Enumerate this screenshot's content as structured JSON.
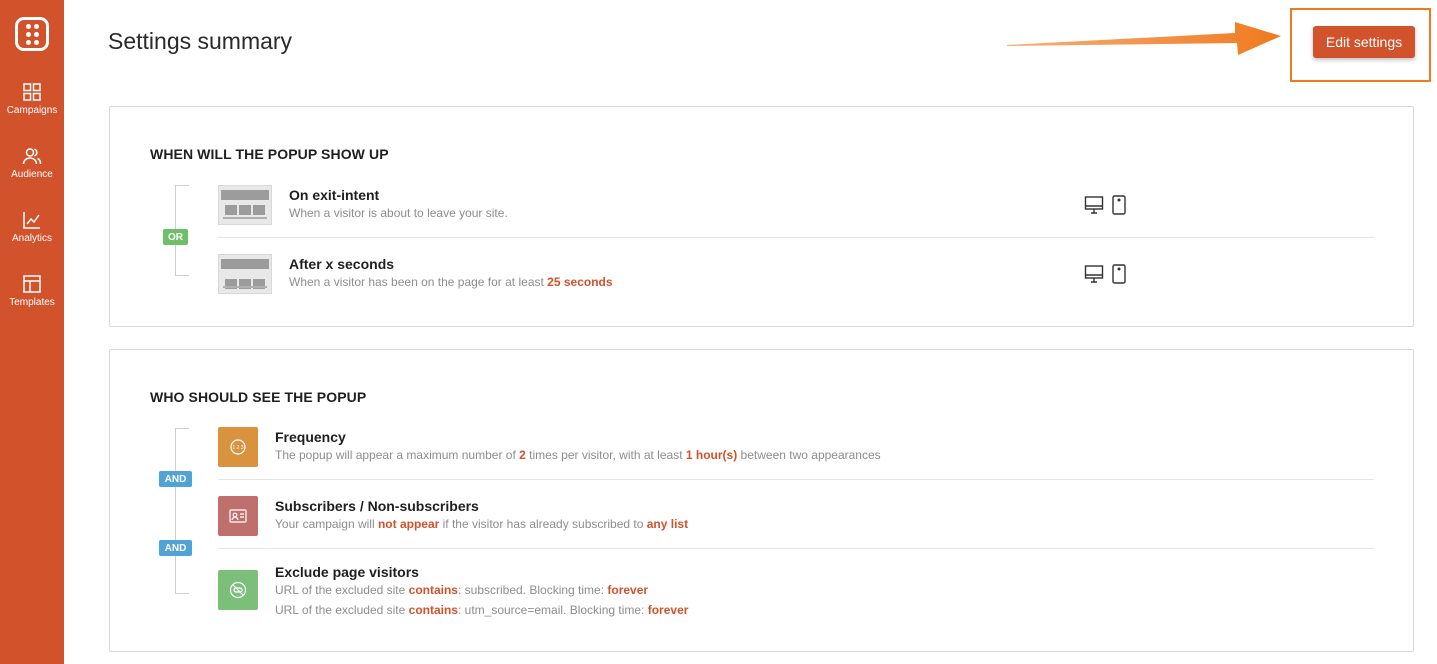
{
  "sidebar": {
    "logo": "keyboard-dots-logo",
    "items": [
      {
        "label": "Campaigns",
        "icon": "grid-icon"
      },
      {
        "label": "Audience",
        "icon": "users-icon"
      },
      {
        "label": "Analytics",
        "icon": "chart-line-icon"
      },
      {
        "label": "Templates",
        "icon": "layout-icon"
      }
    ]
  },
  "header": {
    "title": "Settings summary",
    "edit_button": "Edit settings"
  },
  "when": {
    "title": "WHEN WILL THE POPUP SHOW UP",
    "connector": "OR",
    "items": [
      {
        "title": "On exit-intent",
        "desc": "When a visitor is about to leave your site."
      },
      {
        "title": "After x seconds",
        "desc_prefix": "When a visitor has been on the page for at least ",
        "desc_value": "25 seconds"
      }
    ]
  },
  "who": {
    "title": "WHO SHOULD SEE THE POPUP",
    "connector": "AND",
    "frequency": {
      "title": "Frequency",
      "p1": "The popup will appear a maximum number of ",
      "v1": "2",
      "p2": " times per visitor, with at least ",
      "v2": "1 hour(s)",
      "p3": " between two appearances"
    },
    "subscribers": {
      "title": "Subscribers / Non-subscribers",
      "p1": "Your campaign will ",
      "v1": "not appear",
      "p2": " if the visitor has already subscribed to ",
      "v2": "any list"
    },
    "exclude": {
      "title": "Exclude page visitors",
      "lines": [
        {
          "p1": "URL of the excluded site ",
          "v1": "contains",
          "p2": ": subscribed. Blocking time: ",
          "v2": "forever"
        },
        {
          "p1": "URL of the excluded site ",
          "v1": "contains",
          "p2": ": utm_source=email. Blocking time: ",
          "v2": "forever"
        }
      ]
    }
  },
  "colors": {
    "brand": "#d2522c",
    "annotation": "#f07a1e",
    "or_badge": "#6dbf6a",
    "and_badge": "#4fa3d6",
    "frequency_icon": "#d9923e",
    "subscribers_icon": "#c0706c",
    "exclude_icon": "#7bbf7a"
  }
}
